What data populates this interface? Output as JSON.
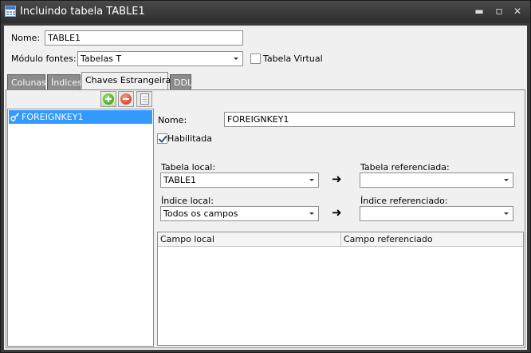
{
  "window": {
    "title": "Incluindo tabela TABLE1",
    "controls": {
      "minimize": "▬",
      "maximize": "▫",
      "close": "✕"
    }
  },
  "form": {
    "nome_label": "Nome:",
    "nome_value": "TABLE1",
    "modulo_label": "Módulo fontes:",
    "modulo_value": "Tabelas T",
    "tabela_virtual_label": "Tabela Virtual",
    "tabela_virtual_checked": false
  },
  "tabs": [
    {
      "label": "Colunas",
      "active": false
    },
    {
      "label": "Índices",
      "active": false
    },
    {
      "label": "Chaves Estrangeiras",
      "active": true
    },
    {
      "label": "DDL",
      "active": false
    }
  ],
  "toolbar": {
    "add_icon": "add-icon",
    "remove_icon": "remove-icon",
    "copy_icon": "copy-icon"
  },
  "foreign_keys": {
    "items": [
      {
        "label": "FOREIGNKEY1",
        "selected": true
      }
    ]
  },
  "detail": {
    "nome_label": "Nome:",
    "nome_value": "FOREIGNKEY1",
    "habilitada_label": "Habilitada",
    "habilitada_checked": true,
    "tabela_local_label": "Tabela local:",
    "tabela_local_value": "TABLE1",
    "tabela_referenciada_label": "Tabela referenciada:",
    "tabela_referenciada_value": "",
    "indice_local_label": "Índice local:",
    "indice_local_value": "Todos os campos",
    "indice_referenciado_label": "Índice referenciado:",
    "indice_referenciado_value": "",
    "arrow": "➜",
    "grid_columns": [
      "Campo local",
      "Campo referenciado"
    ]
  },
  "colors": {
    "selection": "#3399ff",
    "titlebar": "#3a3a3a",
    "client": "#f0f0f0"
  }
}
